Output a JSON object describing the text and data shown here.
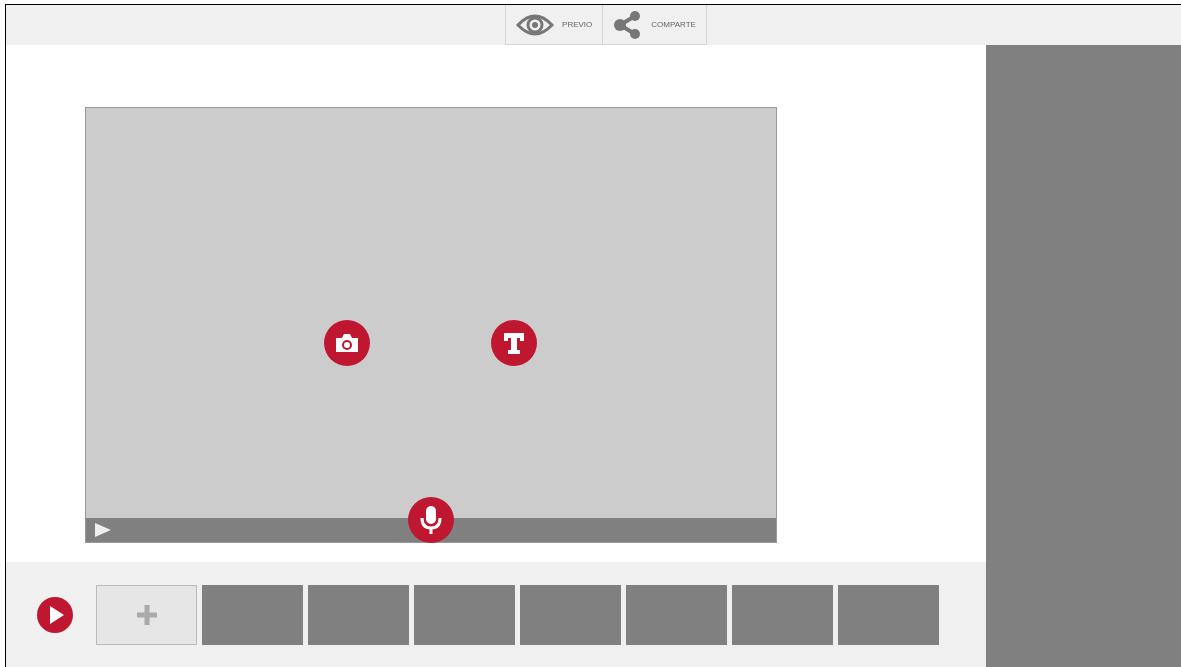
{
  "toolbar": [
    {
      "kind": "eye",
      "label": "PREVIO"
    },
    {
      "kind": "share",
      "label": "COMPARTE"
    }
  ],
  "stage": {
    "tools": [
      {
        "kind": "camera"
      },
      {
        "kind": "text"
      }
    ]
  },
  "timeline": {
    "slots": [
      {
        "kind": "add"
      },
      {
        "kind": "clip"
      },
      {
        "kind": "clip"
      },
      {
        "kind": "clip"
      },
      {
        "kind": "clip"
      },
      {
        "kind": "clip"
      },
      {
        "kind": "clip"
      },
      {
        "kind": "clip"
      }
    ]
  }
}
